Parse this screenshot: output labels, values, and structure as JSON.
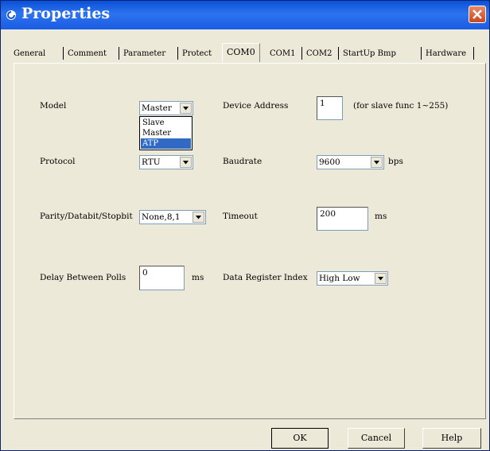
{
  "window": {
    "title": "Properties"
  },
  "tabs": [
    "General",
    "Comment",
    "Parameter",
    "Protect",
    "COM0",
    "COM1",
    "COM2",
    "StartUp Bmp",
    "Hardware"
  ],
  "active_tab": "COM0",
  "form": {
    "model": {
      "label": "Model",
      "value": "Master",
      "options": [
        "Slave",
        "Master",
        "ATP"
      ],
      "highlighted": "ATP"
    },
    "device_address": {
      "label": "Device Address",
      "value": "1",
      "hint": "(for slave func 1~255)"
    },
    "protocol": {
      "label": "Protocol",
      "value": "RTU"
    },
    "baudrate": {
      "label": "Baudrate",
      "value": "9600",
      "unit": "bps"
    },
    "parity": {
      "label": "Parity/Databit/Stopbit",
      "value": "None,8,1"
    },
    "timeout": {
      "label": "Timeout",
      "value": "200",
      "unit": "ms"
    },
    "delay": {
      "label": "Delay Between Polls",
      "value": "0",
      "unit": "ms"
    },
    "register_index": {
      "label": "Data Register Index",
      "value": "High Low"
    }
  },
  "buttons": {
    "ok": "OK",
    "cancel": "Cancel",
    "help": "Help"
  }
}
